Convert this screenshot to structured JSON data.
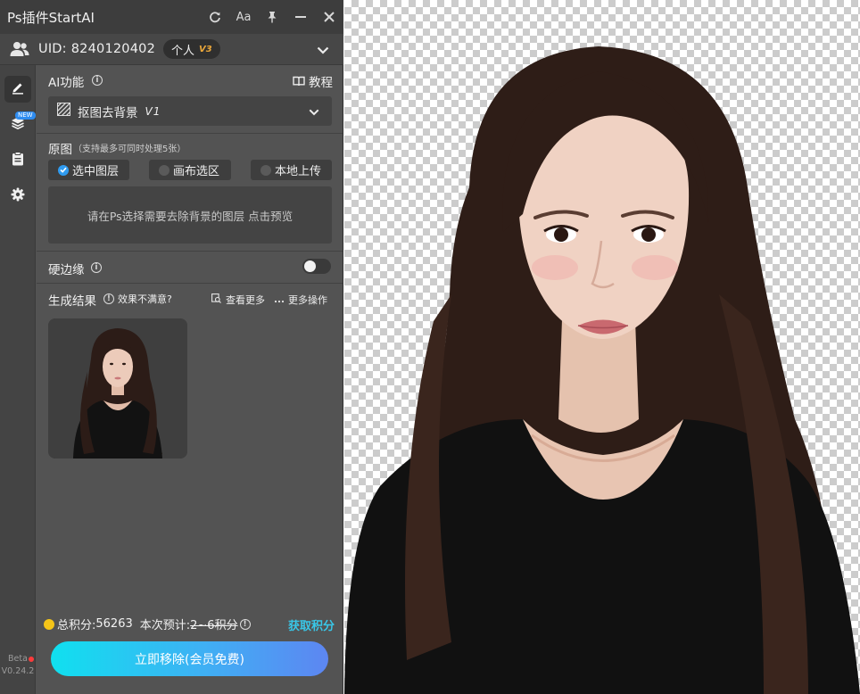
{
  "window": {
    "title": "Ps插件StartAI"
  },
  "titlebar_icons": [
    "refresh-icon",
    "font-size-icon",
    "pin-icon",
    "minimize-icon",
    "close-icon"
  ],
  "titlebar": {
    "font_label": "Aa"
  },
  "account": {
    "uid_label": "UID:",
    "uid_value": "8240120402",
    "plan": "个人",
    "plan_tier": "V3"
  },
  "rail": {
    "new_badge": "NEW",
    "beta_label": "Beta",
    "version": "V0.24.2"
  },
  "ai": {
    "label": "AI功能",
    "tutorial": "教程",
    "selected_feature": "抠图去背景",
    "feature_version": "V1"
  },
  "source": {
    "label": "原图",
    "hint": "（支持最多可同时处理5张）",
    "options": [
      "选中图层",
      "画布选区",
      "本地上传"
    ],
    "selected_option": "选中图层",
    "dropzone_text": "请在Ps选择需要去除背景的图层 点击预览"
  },
  "hard_edge": {
    "label": "硬边缘",
    "enabled": false
  },
  "results": {
    "label": "生成结果",
    "unsatisfied": "效果不满意?",
    "view_more": "查看更多",
    "more_actions": "更多操作"
  },
  "footer": {
    "points_label": "总积分:",
    "points_value": "56263",
    "estimate_label": "本次预计:",
    "estimate_value": "2~6积分",
    "earn_link": "获取积分",
    "cta_label": "立即移除(会员免费)"
  },
  "colors": {
    "panel_bg": "#535353",
    "accent_blue": "#2f9bf0",
    "cta_start": "#10e0ef",
    "cta_end": "#5d86f2",
    "earn_link": "#39c7e8",
    "coin": "#f5c518",
    "plan_tier": "#e9a63a"
  }
}
